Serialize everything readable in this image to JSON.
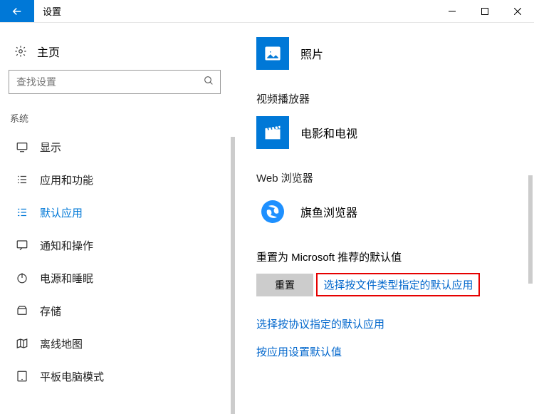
{
  "titlebar": {
    "title": "设置"
  },
  "sidebar": {
    "home": "主页",
    "search_placeholder": "查找设置",
    "category": "系统",
    "items": [
      {
        "label": "显示"
      },
      {
        "label": "应用和功能"
      },
      {
        "label": "默认应用"
      },
      {
        "label": "通知和操作"
      },
      {
        "label": "电源和睡眠"
      },
      {
        "label": "存储"
      },
      {
        "label": "离线地图"
      },
      {
        "label": "平板电脑模式"
      }
    ]
  },
  "main": {
    "photos": {
      "label": "照片"
    },
    "video_section": "视频播放器",
    "video_app": {
      "label": "电影和电视"
    },
    "web_section": "Web 浏览器",
    "web_app": {
      "label": "旗鱼浏览器"
    },
    "reset_label": "重置为 Microsoft 推荐的默认值",
    "reset_button": "重置",
    "link_filetype": "选择按文件类型指定的默认应用",
    "link_protocol": "选择按协议指定的默认应用",
    "link_byapp": "按应用设置默认值"
  }
}
